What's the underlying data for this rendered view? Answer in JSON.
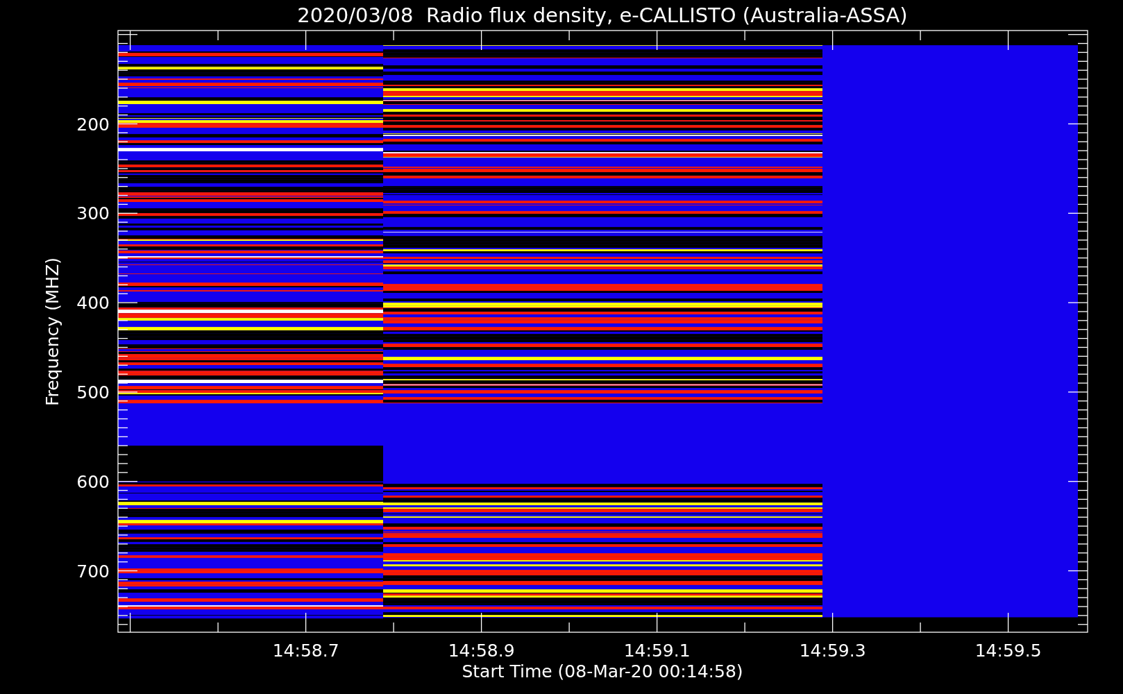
{
  "title": "2020/03/08  Radio flux density, e-CALLISTO (Australia-ASSA)",
  "y_axis": {
    "label": "Frequency (MHZ)",
    "tick_labels": [
      "200",
      "300",
      "400",
      "500",
      "600",
      "700"
    ]
  },
  "x_axis": {
    "label": "Start Time (08-Mar-20 00:14:58)",
    "tick_labels": [
      "14:58.7",
      "14:58.9",
      "14:59.1",
      "14:59.3",
      "14:59.5"
    ]
  }
}
